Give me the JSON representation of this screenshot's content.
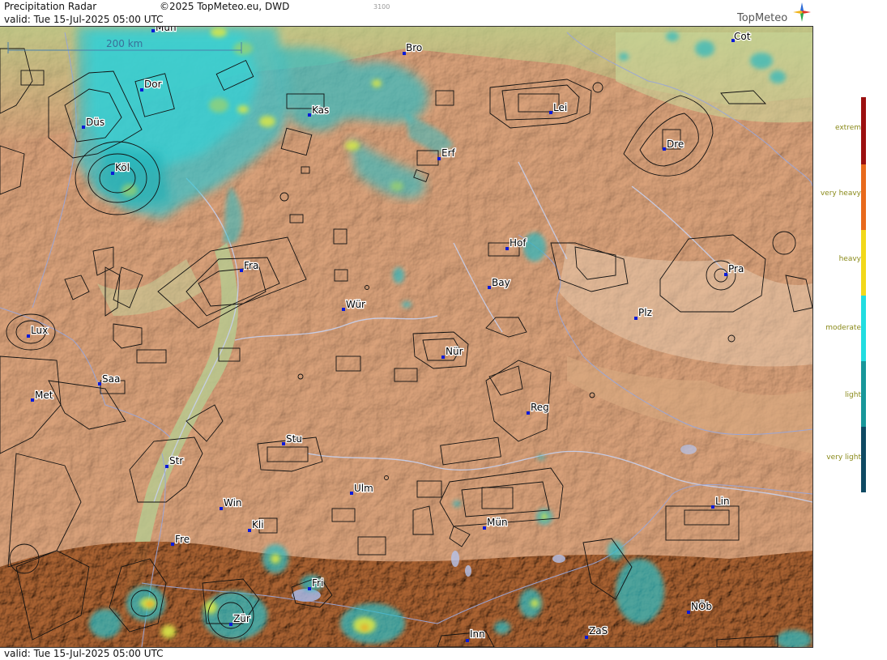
{
  "header": {
    "title": "Precipitation Radar",
    "copyright": "©2025 TopMeteo.eu, DWD",
    "valid": "valid:  Tue  15-Jul-2025 05:00 UTC",
    "code": "3100",
    "logo_text": "TopMeteo"
  },
  "footer": {
    "valid": "valid:  Tue  15-Jul-2025 05:00 UTC"
  },
  "scale": {
    "label": "200 km"
  },
  "legend": {
    "items": [
      {
        "label": "extrem",
        "color": "#9b1010"
      },
      {
        "label": "very heavy",
        "color": "#e86a1c"
      },
      {
        "label": "heavy",
        "color": "#f2d81a"
      },
      {
        "label": "moderate",
        "color": "#22dde0"
      },
      {
        "label": "light",
        "color": "#18979a"
      },
      {
        "label": "very light",
        "color": "#0f4a63"
      }
    ]
  },
  "cities": [
    {
      "name": "Mün"
    },
    {
      "name": "Bro"
    },
    {
      "name": "Cot"
    },
    {
      "name": "Dor"
    },
    {
      "name": "Kas"
    },
    {
      "name": "Lei"
    },
    {
      "name": "Düs"
    },
    {
      "name": "Dre"
    },
    {
      "name": "Erf"
    },
    {
      "name": "Köl"
    },
    {
      "name": "Hof"
    },
    {
      "name": "Fra"
    },
    {
      "name": "Pra"
    },
    {
      "name": "Bay"
    },
    {
      "name": "Wür"
    },
    {
      "name": "Plz"
    },
    {
      "name": "Lux"
    },
    {
      "name": "Nür"
    },
    {
      "name": "Saa"
    },
    {
      "name": "Met"
    },
    {
      "name": "Reg"
    },
    {
      "name": "Stu"
    },
    {
      "name": "Str"
    },
    {
      "name": "Ulm"
    },
    {
      "name": "Win"
    },
    {
      "name": "Lin"
    },
    {
      "name": "Kli"
    },
    {
      "name": "Mün"
    },
    {
      "name": "Fre"
    },
    {
      "name": "Fri"
    },
    {
      "name": "NÖb"
    },
    {
      "name": "Zür"
    },
    {
      "name": "ZaS"
    },
    {
      "name": "Inn"
    }
  ]
}
